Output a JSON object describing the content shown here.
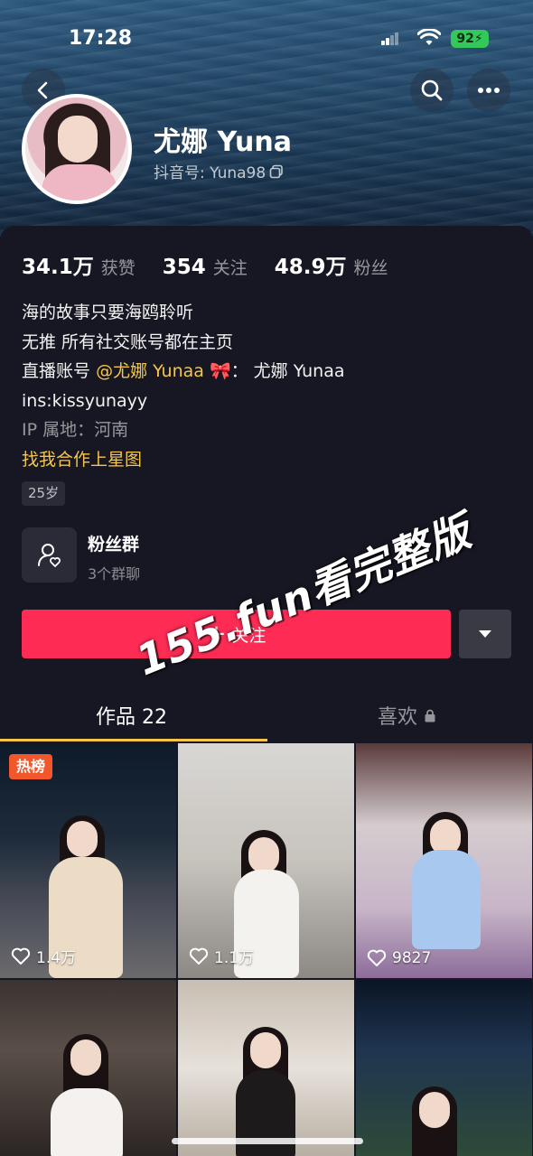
{
  "status_bar": {
    "time": "17:28",
    "battery": "92"
  },
  "profile": {
    "name": "尤娜 Yuna",
    "douyin_id": "抖音号: Yuna98"
  },
  "stats": [
    {
      "value": "34.1万",
      "label": "获赞"
    },
    {
      "value": "354",
      "label": "关注"
    },
    {
      "value": "48.9万",
      "label": "粉丝"
    }
  ],
  "bio": {
    "line1": "海的故事只要海鸥聆听",
    "line2": "无推  所有社交账号都在主页",
    "line3_prefix": "直播账号",
    "line3_mention": "@尤娜 Yunaa",
    "line3_suffix": "：  尤娜 Yunaa",
    "line4": "ins:kissyunayy",
    "ip": "IP 属地：河南",
    "star_link": "找我合作上星图",
    "age": "25岁"
  },
  "fan_group": {
    "title": "粉丝群",
    "subtitle": "3个群聊"
  },
  "actions": {
    "follow": "关注"
  },
  "tabs": {
    "works": "作品 22",
    "likes": "喜欢"
  },
  "grid": [
    {
      "likes": "1.4万",
      "badge": "热榜"
    },
    {
      "likes": "1.1万"
    },
    {
      "likes": "9827"
    },
    {},
    {},
    {}
  ],
  "watermark": "155.fun看完整版",
  "colors": {
    "accent": "#fe2c55",
    "highlight": "#f5c64b",
    "background": "#161722"
  }
}
